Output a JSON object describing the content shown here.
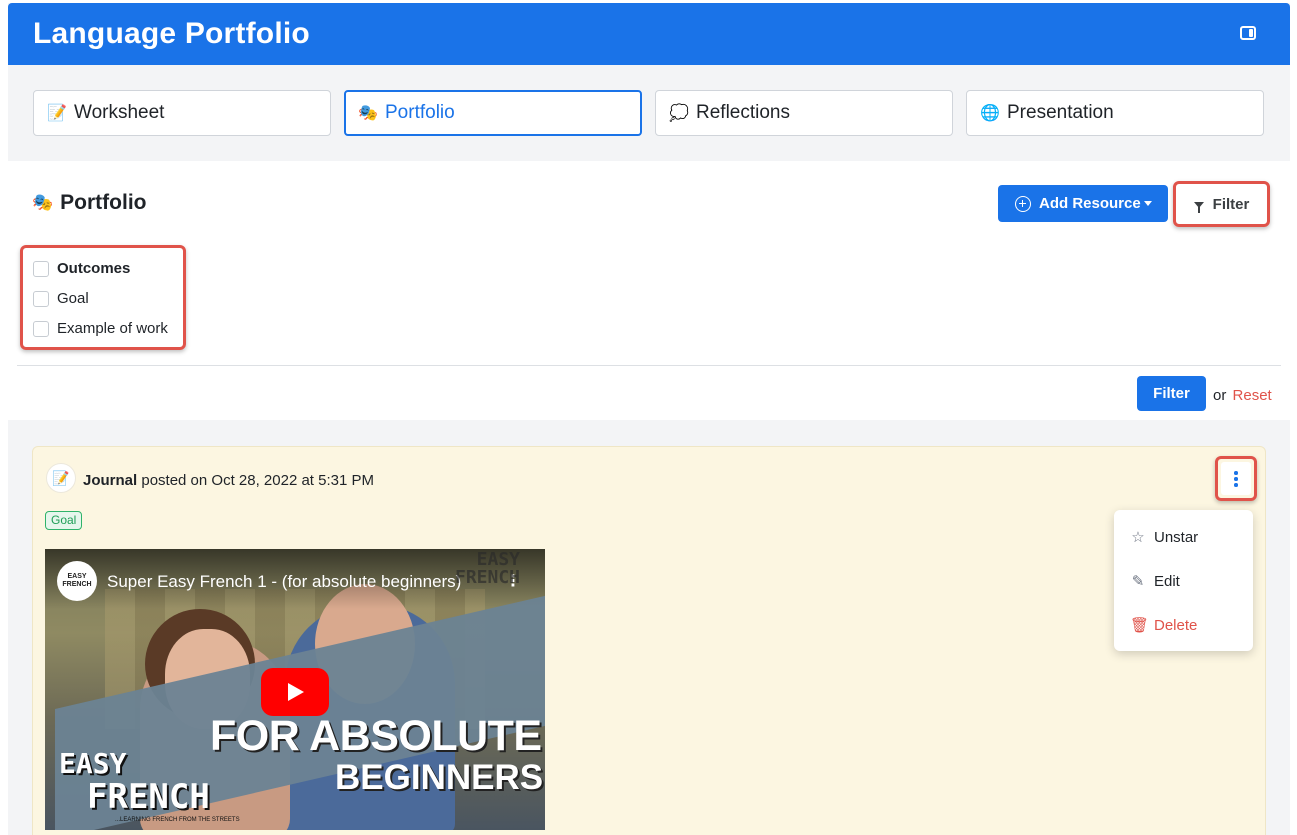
{
  "header": {
    "title": "Language Portfolio"
  },
  "tabs": [
    {
      "label": "Worksheet",
      "emoji": "📝",
      "active": false
    },
    {
      "label": "Portfolio",
      "emoji": "🎭",
      "active": true
    },
    {
      "label": "Reflections",
      "emoji": "💭",
      "active": false
    },
    {
      "label": "Presentation",
      "emoji": "🌐",
      "active": false
    }
  ],
  "panel": {
    "title": "Portfolio",
    "title_emoji": "🎭",
    "add_resource_label": "Add Resource",
    "filter_label": "Filter",
    "filter_options": [
      {
        "label": "Outcomes",
        "checked": false,
        "bold": true
      },
      {
        "label": "Goal",
        "checked": false,
        "bold": false
      },
      {
        "label": "Example of work",
        "checked": false,
        "bold": false
      }
    ],
    "apply_filter_label": "Filter",
    "or_text": "or",
    "reset_label": "Reset"
  },
  "post": {
    "avatar_emoji": "📝",
    "author": "Journal",
    "meta": " posted on Oct 28, 2022 at 5:31 PM",
    "tag": "Goal",
    "menu": {
      "items": [
        {
          "label": "Unstar",
          "icon": "star-outline-icon"
        },
        {
          "label": "Edit",
          "icon": "pencil-icon"
        },
        {
          "label": "Delete",
          "icon": "trash-icon"
        }
      ]
    },
    "video": {
      "title": "Super Easy French 1 - (for absolute beginners)",
      "channel_logo_text": "EASY FRENCH",
      "corner_brand_line1": "EASY",
      "corner_brand_line2": "FRENCH",
      "overlay_line1": "FOR ABSOLUTE",
      "overlay_line2": "BEGINNERS",
      "logo_line1": "EASY",
      "logo_line2": "FRENCH",
      "tagline": "...LEARNING FRENCH FROM THE STREETS"
    }
  },
  "colors": {
    "primary": "#1a73e8",
    "highlight": "#e0534a",
    "card_bg": "#fcf6e1",
    "tag_green": "#1e9e56",
    "danger": "#e0534a"
  }
}
